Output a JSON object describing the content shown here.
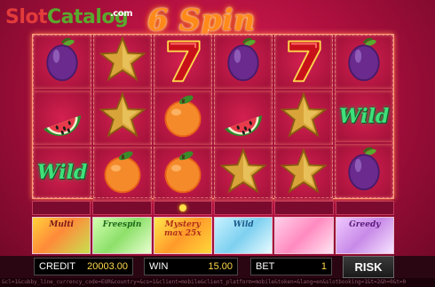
{
  "watermark": {
    "slot": "Slot",
    "catalog": "Catalog",
    "com": ".com"
  },
  "game": {
    "logo": "6 Spin"
  },
  "colors": {
    "background": "#c8154a",
    "cell": "#a8133c",
    "border_glow": "#ff9b7a",
    "wild": "#3fe07a",
    "value_text": "#ffd84a"
  },
  "reels": [
    [
      "plum",
      "watermelon",
      "wild"
    ],
    [
      "star",
      "star",
      "orange"
    ],
    [
      "seven",
      "orange",
      "orange"
    ],
    [
      "plum",
      "watermelon",
      "star"
    ],
    [
      "seven",
      "star",
      "star"
    ],
    [
      "plum",
      "wild",
      "plum"
    ]
  ],
  "symbols": {
    "wild_label": "Wild"
  },
  "features": [
    {
      "label": "Multi"
    },
    {
      "label": "Freespin"
    },
    {
      "label": "Mystery",
      "sub": "max 25x"
    },
    {
      "label": "Wild"
    },
    {
      "label": ""
    },
    {
      "label": "Greedy"
    }
  ],
  "bottom": {
    "credit_label": "CREDIT",
    "credit_value": "20003.00",
    "win_label": "WIN",
    "win_value": "15.00",
    "bet_label": "BET",
    "bet_value": "1",
    "risk_label": "RISK"
  },
  "footer_text": "&cl=1&cubby_line_currency_code=EUR&country=&cs=1&client=mobile&client_platform=mobile&token=&lang=en&slotbooking=1&t=2&h=0&t=0"
}
